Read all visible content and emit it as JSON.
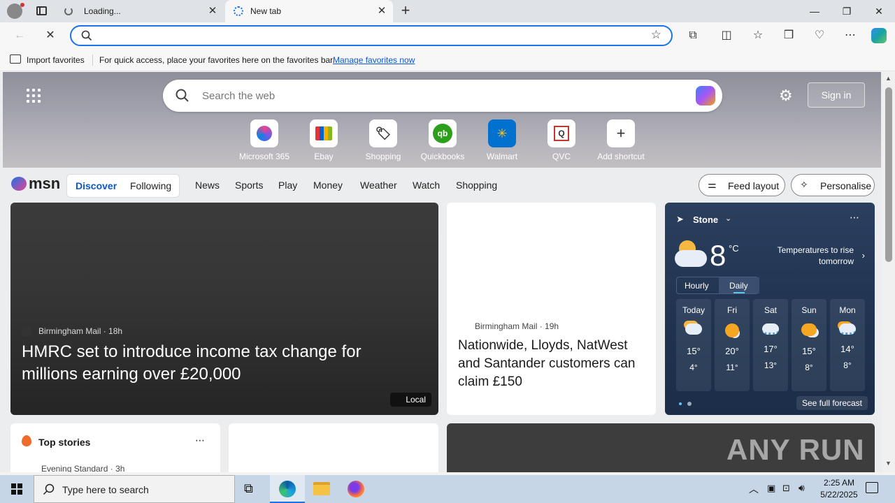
{
  "browser": {
    "tabs": [
      {
        "title": "Loading..."
      },
      {
        "title": "New tab"
      }
    ],
    "address_placeholder": ""
  },
  "favorites_bar": {
    "import_label": "Import favorites",
    "message": "For quick access, place your favorites here on the favorites bar.",
    "manage_link": "Manage favorites now"
  },
  "newtab": {
    "search_placeholder": "Search the web",
    "sign_in": "Sign in",
    "shortcuts": [
      {
        "label": "Microsoft 365",
        "icon": "microsoft365-icon"
      },
      {
        "label": "Ebay",
        "icon": "ebay-bag-icon"
      },
      {
        "label": "Shopping",
        "icon": "tag-icon"
      },
      {
        "label": "Quickbooks",
        "icon": "quickbooks-icon"
      },
      {
        "label": "Walmart",
        "icon": "walmart-icon"
      },
      {
        "label": "QVC",
        "icon": "qvc-icon"
      },
      {
        "label": "Add shortcut",
        "icon": "plus-icon"
      }
    ]
  },
  "msn": {
    "logo": "msn",
    "toggle": {
      "discover": "Discover",
      "following": "Following"
    },
    "nav": [
      "News",
      "Sports",
      "Play",
      "Money",
      "Weather",
      "Watch",
      "Shopping"
    ],
    "feed_layout": "Feed layout",
    "personalise": "Personalise"
  },
  "cards": {
    "hero": {
      "source": "Birmingham Mail",
      "age": "18h",
      "headline": "HMRC set to introduce income tax change for millions earning over £20,000",
      "badge": "Local"
    },
    "second": {
      "source": "Birmingham Mail",
      "age": "19h",
      "headline": "Nationwide, Lloyds, NatWest and Santander customers can claim £150"
    },
    "top_stories": {
      "title": "Top stories",
      "first_source": "Evening Standard",
      "first_age": "3h"
    }
  },
  "weather": {
    "location": "Stone",
    "temp": "8",
    "unit": "°C",
    "note": "Temperatures to rise tomorrow",
    "tabs": [
      "Hourly",
      "Daily"
    ],
    "days": [
      {
        "day": "Today",
        "hi": "15°",
        "lo": "4°",
        "icon": "partly-cloudy-icon"
      },
      {
        "day": "Fri",
        "hi": "20°",
        "lo": "11°",
        "icon": "sunny-cloud-icon"
      },
      {
        "day": "Sat",
        "hi": "17°",
        "lo": "13°",
        "icon": "rain-cloud-icon"
      },
      {
        "day": "Sun",
        "hi": "15°",
        "lo": "8°",
        "icon": "sun-cloud-icon"
      },
      {
        "day": "Mon",
        "hi": "14°",
        "lo": "8°",
        "icon": "sun-rain-icon"
      }
    ],
    "forecast_link": "See full forecast"
  },
  "taskbar": {
    "search_placeholder": "Type here to search",
    "time": "2:25 AM",
    "date": "5/22/2025"
  },
  "watermark": "ANY RUN"
}
